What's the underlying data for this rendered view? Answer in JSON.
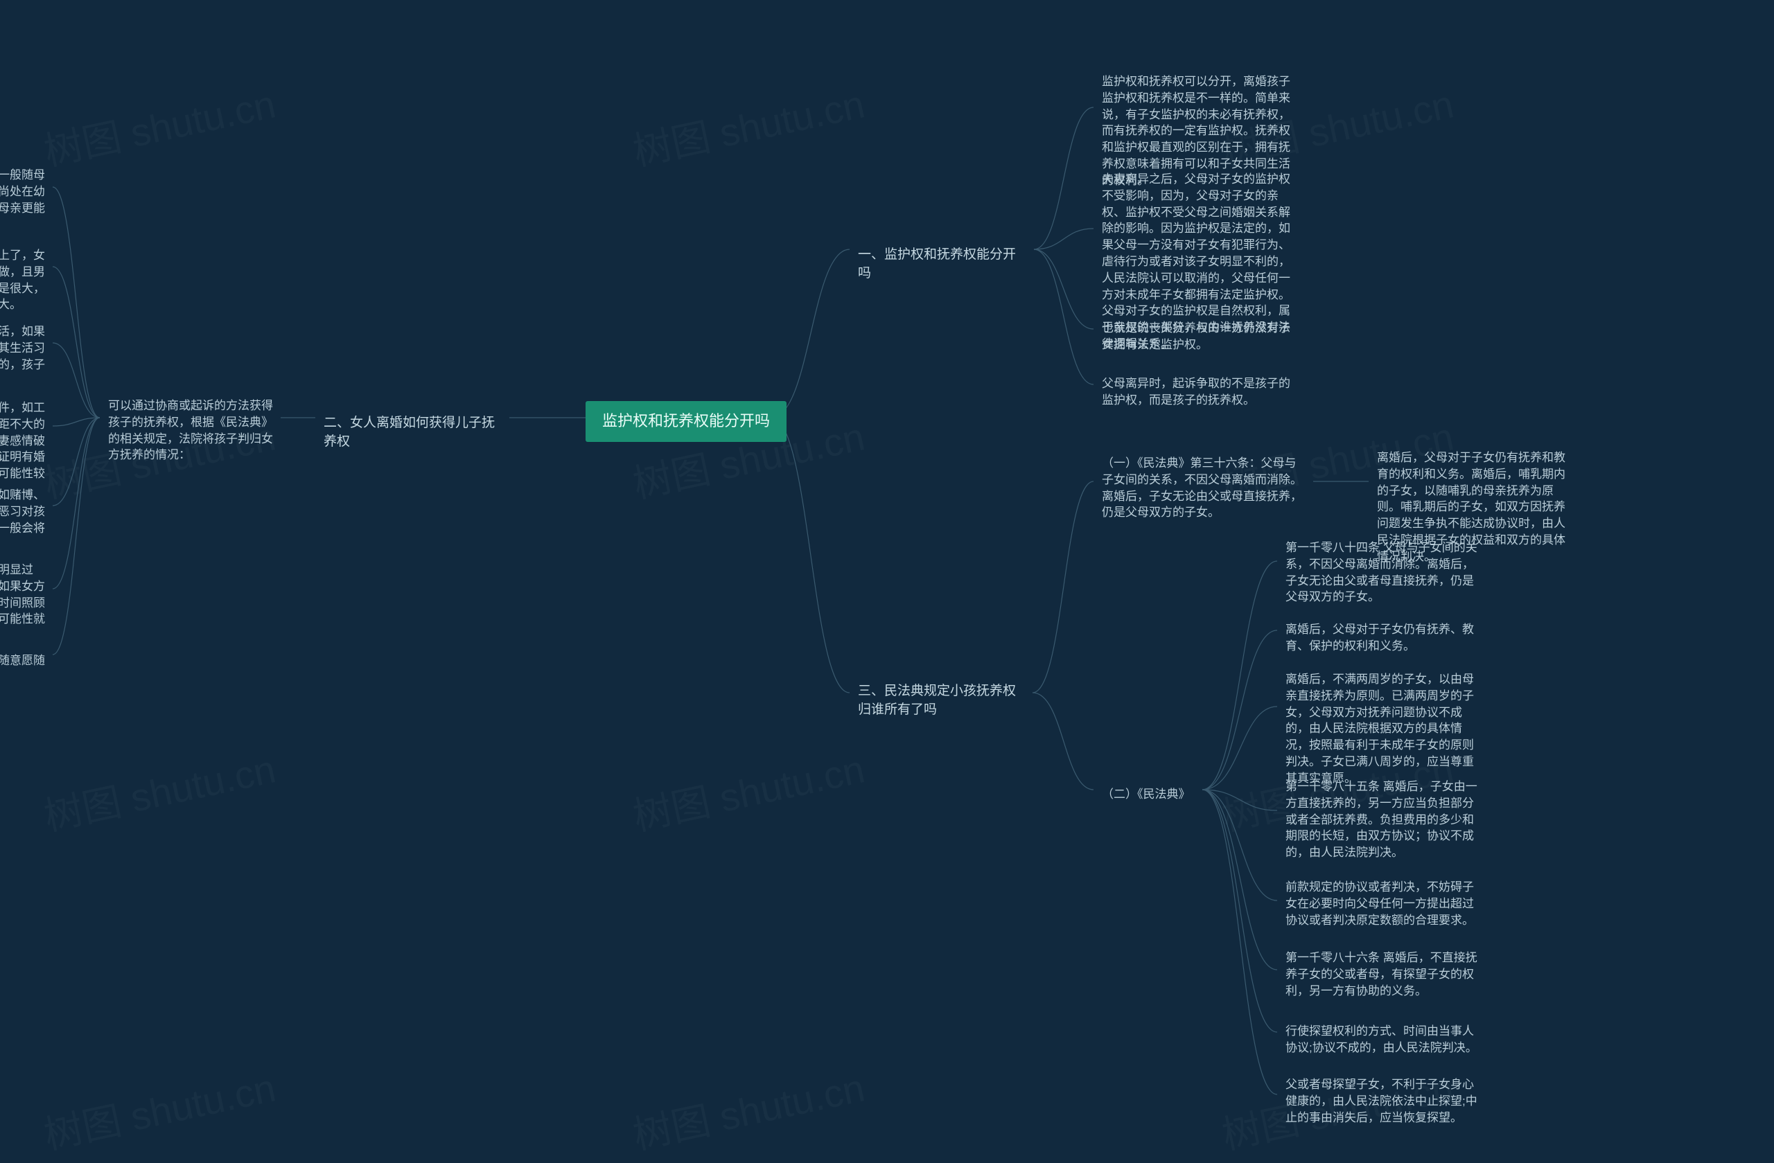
{
  "watermark_text": "树图 shutu.cn",
  "root": "监护权和抚养权能分开吗",
  "b1": {
    "label": "一、监护权和抚养权能分开吗"
  },
  "b1_c1": "监护权和抚养权可以分开，离婚孩子监护权和抚养权是不一样的。简单来说，有子女监护权的未必有抚养权，而有抚养权的一定有监护权。抚养权和监护权最直观的区别在于，拥有抚养权意味着拥有可以和子女共同生活的权利。",
  "b1_c2": "夫妻离异之后，父母对子女的监护权不受影响，因为，父母对子女的亲权、监护权不受父母之间婚姻关系解除的影响。因为监护权是法定的，如果父母一方没有对子女有犯罪行为、虐待行为或者对该子女明显不利的，人民法院认可以取消的，父母任何一方对未成年子女都拥有法定监护权。父母对子女的监护权是自然权利，属于亲权的一部分，与由谁抚养没有法律逻辑关系。",
  "b1_c3": "也就是说丧失抚养权的一方仍然对子女拥有法定监护权。",
  "b1_c4": "父母离异时，起诉争取的不是孩子的监护权，而是孩子的抚养权。",
  "b2": {
    "label": "二、女人离婚如何获得儿子抚养权"
  },
  "b2_desc": "可以通过协商或起诉的方法获得孩子的抚养权，根据《民法典》的相关规定，法院将孩子判归女方抚养的情况：",
  "b2_c1": "（一）两周岁以内的子女一般随母亲生活。这主要考虑孩子尚处在幼儿期，需要母亲的哺乳，母亲更能给孩子体贴和照顾。",
  "b2_c2": "（二）孩子虽然两周岁以上了，女方已做绝育手术，男方未做，且男方年龄与女方年龄差距不是很大，孩子判归女方的可能性较大。",
  "b2_c3": "（三）孩子一直随母亲生活，如果离婚后改为随父亲生活对其生活习惯改变较大且影响其成长的，孩子判归女方可能性较大。",
  "b2_c4": "（四）男女双方的抚养条件，如工作稳定程度、收入情况差距不大的前提下，如果男方对于夫妻感情破裂有过错，比如，有证据证明有婚外情等，孩子判归女方的可能性较大。",
  "b2_c5": "（五）男方有不良嗜好，如赌博、酗酒等恶习等。考虑到其恶习对孩子成长有不利影响，法院一般会将孩子判归女方。",
  "b2_c6": "（六）如果男女双方均无明显过错，各方面条件都相当，如果女方的思想品质好一些，更有时间照顾孩子，得到孩子抚养权的可能性就会更大。",
  "b2_c7": "（七）十周岁以上的孩子随意愿随母亲生活的。",
  "b3": {
    "label": "三、民法典规定小孩抚养权归谁所有了吗"
  },
  "b3_a": "（一）《民法典》第三十六条：父母与子女间的关系，不因父母离婚而消除。离婚后，子女无论由父或母直接抚养，仍是父母双方的子女。",
  "b3_a_side": "离婚后，父母对于子女仍有抚养和教育的权利和义务。离婚后，哺乳期内的子女，以随哺乳的母亲抚养为原则。哺乳期后的子女，如双方因抚养问题发生争执不能达成协议时，由人民法院根据子女的权益和双方的具体情况判决。",
  "b3_b": "（二）《民法典》",
  "b3_b_1": "第一千零八十四条 父母与子女间的关系，不因父母离婚而消除。离婚后，子女无论由父或者母直接抚养，仍是父母双方的子女。",
  "b3_b_2": "离婚后，父母对于子女仍有抚养、教育、保护的权利和义务。",
  "b3_b_3": "离婚后，不满两周岁的子女，以由母亲直接抚养为原则。已满两周岁的子女，父母双方对抚养问题协议不成的，由人民法院根据双方的具体情况，按照最有利于未成年子女的原则判决。子女已满八周岁的，应当尊重其真实意愿。",
  "b3_b_4": "第一千零八十五条 离婚后，子女由一方直接抚养的，另一方应当负担部分或者全部抚养费。负担费用的多少和期限的长短，由双方协议；协议不成的，由人民法院判决。",
  "b3_b_5": "前款规定的协议或者判决，不妨碍子女在必要时向父母任何一方提出超过协议或者判决原定数额的合理要求。",
  "b3_b_6": "第一千零八十六条 离婚后，不直接抚养子女的父或者母，有探望子女的权利，另一方有协助的义务。",
  "b3_b_7": "行使探望权利的方式、时间由当事人协议;协议不成的，由人民法院判决。",
  "b3_b_8": "父或者母探望子女，不利于子女身心健康的，由人民法院依法中止探望;中止的事由消失后，应当恢复探望。"
}
